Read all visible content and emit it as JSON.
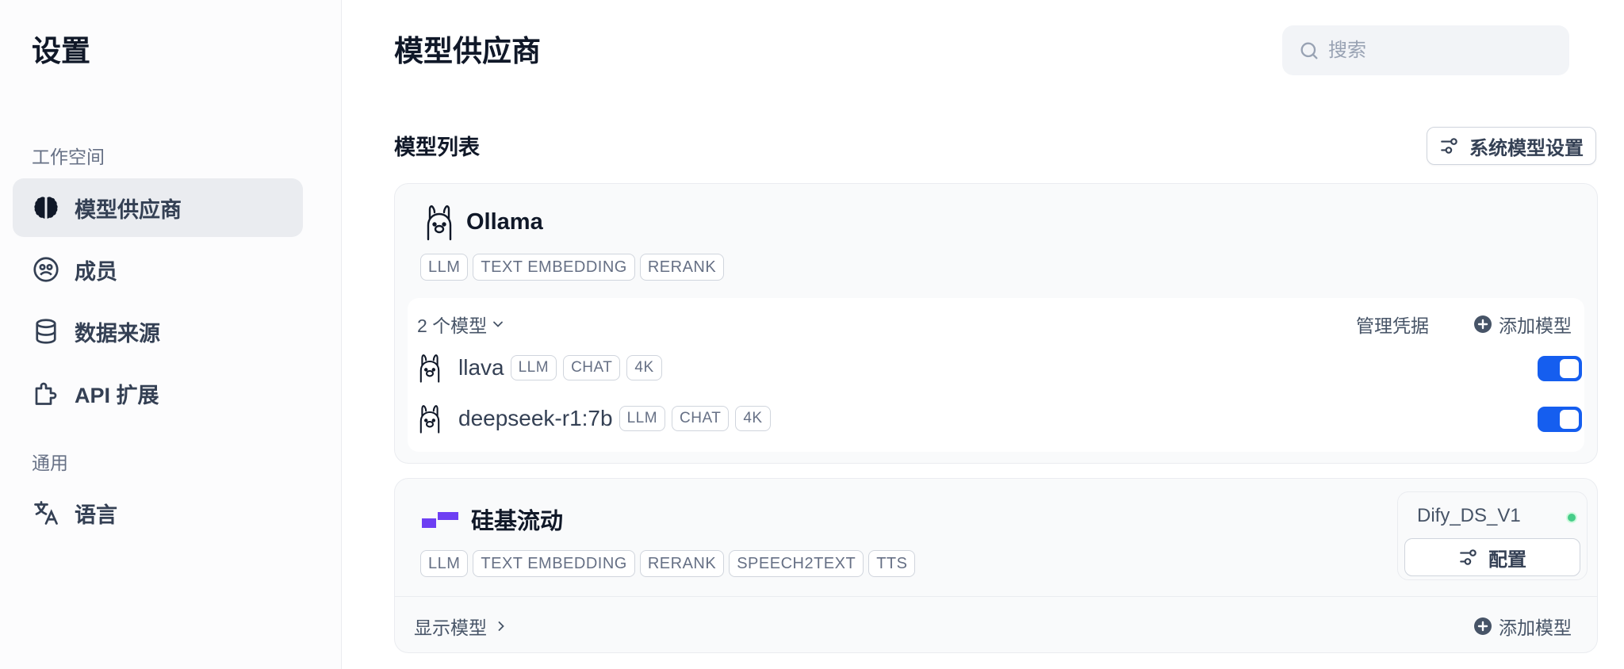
{
  "sidebar": {
    "title": "设置",
    "groups": [
      "工作空间",
      "通用"
    ],
    "items": [
      {
        "label": "模型供应商",
        "icon": "brain-icon",
        "active": true
      },
      {
        "label": "成员",
        "icon": "members-icon"
      },
      {
        "label": "数据来源",
        "icon": "database-icon"
      },
      {
        "label": "API 扩展",
        "icon": "puzzle-icon"
      },
      {
        "label": "语言",
        "icon": "translate-icon"
      }
    ]
  },
  "header": {
    "title": "模型供应商",
    "search_placeholder": "搜索"
  },
  "model_list": {
    "title": "模型列表",
    "system_settings_label": "系统模型设置"
  },
  "providers": [
    {
      "name": "Ollama",
      "icon": "llama-icon",
      "tags": [
        "LLM",
        "TEXT EMBEDDING",
        "RERANK"
      ],
      "models_count": "2 个模型",
      "manage_label": "管理凭据",
      "add_model_label": "添加模型",
      "models": [
        {
          "name": "llava",
          "tags": [
            "LLM",
            "CHAT",
            "4K"
          ],
          "enabled": true
        },
        {
          "name": "deepseek-r1:7b",
          "tags": [
            "LLM",
            "CHAT",
            "4K"
          ],
          "enabled": true
        }
      ]
    },
    {
      "name": "硅基流动",
      "icon": "siliconflow-logo",
      "tags": [
        "LLM",
        "TEXT EMBEDDING",
        "RERANK",
        "SPEECH2TEXT",
        "TTS"
      ],
      "credential": {
        "name": "Dify_DS_V1",
        "status_color": "#47cd89",
        "config_label": "配置"
      },
      "show_models_label": "显示模型",
      "add_model_label": "添加模型"
    }
  ],
  "colors": {
    "accent": "#155eef",
    "brand_purple": "#6e3ff3"
  }
}
